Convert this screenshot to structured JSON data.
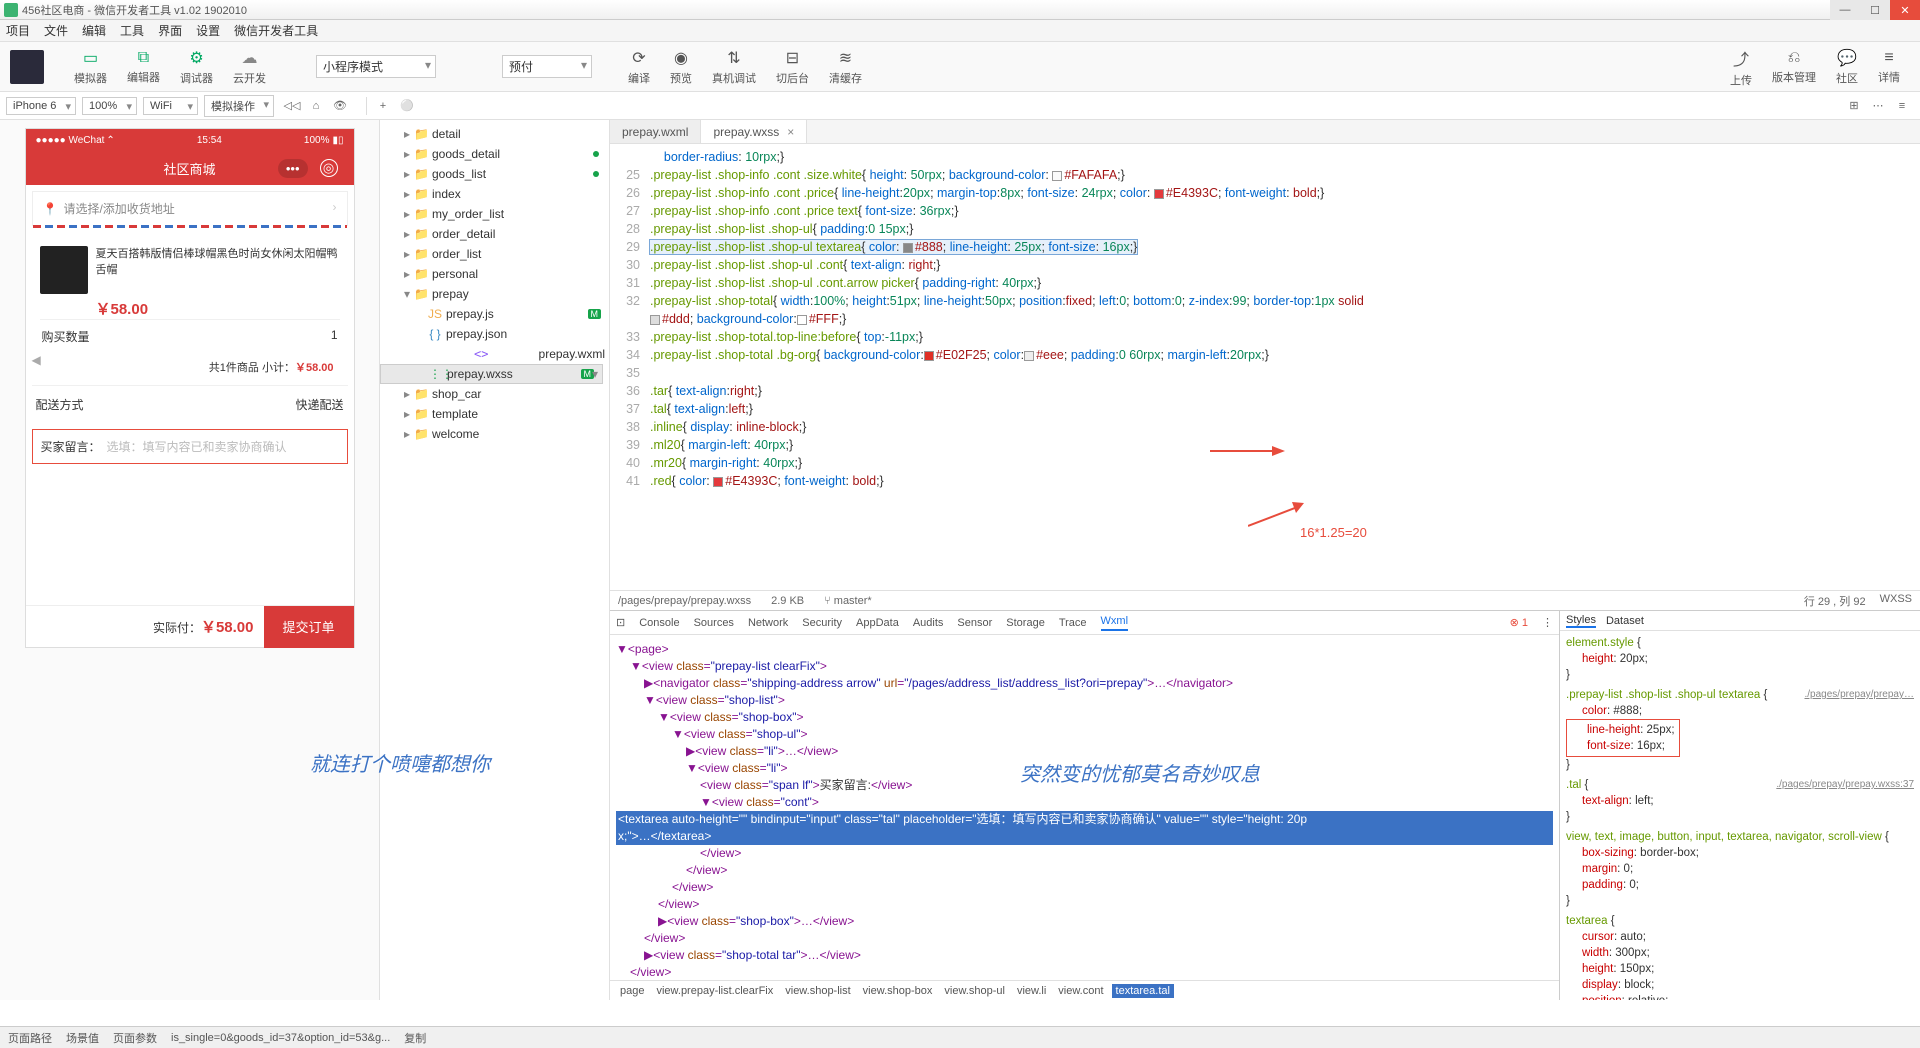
{
  "title": "456社区电商 - 微信开发者工具 v1.02 1902010",
  "menu": [
    "项目",
    "文件",
    "编辑",
    "工具",
    "界面",
    "设置",
    "微信开发者工具"
  ],
  "tool": {
    "sim": "模拟器",
    "edit": "编辑器",
    "dbg": "调试器",
    "cloud": "云开发",
    "mode": "小程序模式",
    "preview": "预付",
    "compile": "编译",
    "prev": "预览",
    "remote": "真机调试",
    "bg": "切后台",
    "cache": "清缓存",
    "upload": "上传",
    "ver": "版本管理",
    "comm": "社区",
    "detail": "详情"
  },
  "subtool": {
    "device": "iPhone 6",
    "zoom": "100%",
    "net": "WiFi",
    "mock": "模拟操作"
  },
  "sim": {
    "carrier": "●●●●● WeChat",
    "time": "15:54",
    "bat": "100%",
    "title": "社区商城",
    "addr_ph": "请选择/添加收货地址",
    "prod": "夏天百搭韩版情侣棒球帽黑色时尚女休闲太阳帽鸭舌帽",
    "price": "￥58.00",
    "qty_l": "购买数量",
    "qty": "1",
    "sub": "共1件商品   小计：",
    "sub_p": "￥58.00",
    "ship_l": "配送方式",
    "ship_v": "快递配送",
    "msg_l": "买家留言：",
    "msg_ph": "选填：填写内容已和卖家协商确认",
    "tot_l": "实际付：",
    "tot_p": "￥58.00",
    "submit": "提交订单"
  },
  "tree": [
    {
      "t": "folder",
      "n": "detail",
      "d": 2
    },
    {
      "t": "folder",
      "n": "goods_detail",
      "d": 2,
      "dot": true
    },
    {
      "t": "folder",
      "n": "goods_list",
      "d": 2,
      "dot": true
    },
    {
      "t": "folder",
      "n": "index",
      "d": 2
    },
    {
      "t": "folder",
      "n": "my_order_list",
      "d": 2
    },
    {
      "t": "folder",
      "n": "order_detail",
      "d": 2
    },
    {
      "t": "folder",
      "n": "order_list",
      "d": 2
    },
    {
      "t": "folder",
      "n": "personal",
      "d": 2
    },
    {
      "t": "folder",
      "n": "prepay",
      "d": 2,
      "open": true
    },
    {
      "t": "js",
      "n": "prepay.js",
      "d": 3,
      "m": true
    },
    {
      "t": "json",
      "n": "prepay.json",
      "d": 3
    },
    {
      "t": "wxml",
      "n": "prepay.wxml",
      "d": 3
    },
    {
      "t": "wxss",
      "n": "prepay.wxss",
      "d": 3,
      "sel": true,
      "m": true
    },
    {
      "t": "folder",
      "n": "shop_car",
      "d": 2
    },
    {
      "t": "folder",
      "n": "template",
      "d": 2
    },
    {
      "t": "folder",
      "n": "welcome",
      "d": 2
    }
  ],
  "tabs": [
    {
      "n": "prepay.wxml"
    },
    {
      "n": "prepay.wxss",
      "act": true
    }
  ],
  "status": {
    "path": "/pages/prepay/prepay.wxss",
    "size": "2.9 KB",
    "branch": "master*",
    "pos": "行 29 , 列 92",
    "lang": "WXSS"
  },
  "devtabs": [
    "Console",
    "Sources",
    "Network",
    "Security",
    "AppData",
    "Audits",
    "Sensor",
    "Storage",
    "Trace",
    "Wxml"
  ],
  "crumb": [
    "page",
    "view.prepay-list.clearFix",
    "view.shop-list",
    "view.shop-box",
    "view.shop-ul",
    "view.li",
    "view.cont",
    "textarea.tal"
  ],
  "stabs": [
    "Styles",
    "Dataset"
  ],
  "ann": "16*1.25=20",
  "bottom": {
    "a": "页面路径",
    "b": "场景值",
    "c": "页面参数",
    "d": "is_single=0&goods_id=37&option_id=53&g...",
    "e": "复制"
  },
  "w1": "就连打个喷嚏都想你",
  "w2": "突然变的忧郁莫名奇妙叹息"
}
